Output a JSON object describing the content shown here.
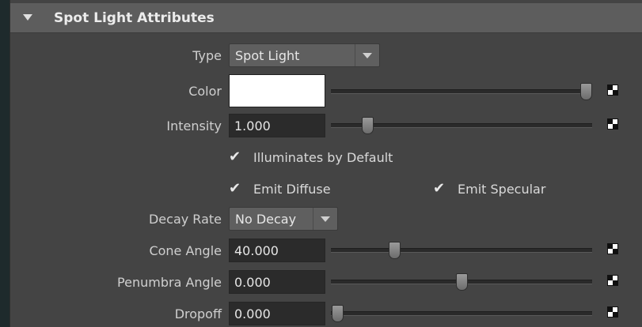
{
  "section": {
    "title": "Spot Light Attributes",
    "expanded": true
  },
  "attributes": {
    "type": {
      "label": "Type",
      "value": "Spot Light"
    },
    "color": {
      "label": "Color",
      "swatch": "#ffffff",
      "slider_fraction": 1.0
    },
    "intensity": {
      "label": "Intensity",
      "value": "1.000",
      "slider_fraction": 0.12
    },
    "illuminates_by_default": {
      "label": "Illuminates by Default",
      "checked": true
    },
    "emit_diffuse": {
      "label": "Emit Diffuse",
      "checked": true
    },
    "emit_specular": {
      "label": "Emit Specular",
      "checked": true
    },
    "decay_rate": {
      "label": "Decay Rate",
      "value": "No Decay"
    },
    "cone_angle": {
      "label": "Cone Angle",
      "value": "40.000",
      "slider_fraction": 0.23
    },
    "penumbra_angle": {
      "label": "Penumbra Angle",
      "value": "0.000",
      "slider_fraction": 0.5
    },
    "dropoff": {
      "label": "Dropoff",
      "value": "0.000",
      "slider_fraction": 0.0
    }
  },
  "icons": {
    "collapse": "triangle-down-icon",
    "dropdown_arrow": "chevron-down-icon",
    "texture_map": "checker-map-icon",
    "check": "checkmark-icon"
  },
  "colors": {
    "panel_bg": "#444444",
    "header_bg": "#5d5d5d",
    "field_bg": "#2b2b2b"
  }
}
